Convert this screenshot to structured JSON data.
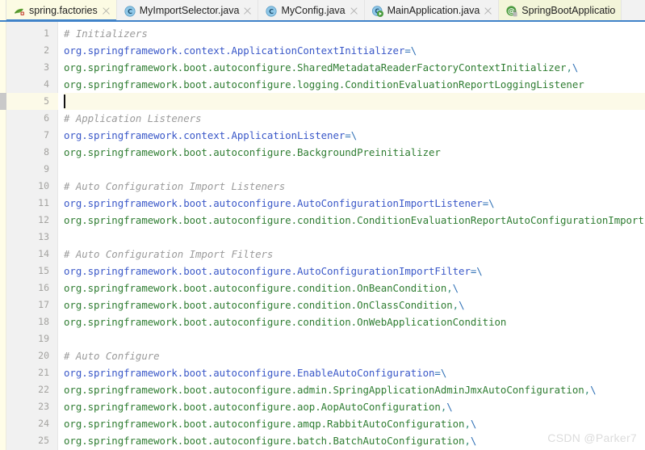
{
  "window": {
    "title": "spring.factories"
  },
  "tabbar": {
    "tabs": [
      {
        "label": "spring.factories",
        "icon": "spring-leaf-icon",
        "active": true,
        "modified": false,
        "closable": true
      },
      {
        "label": "MyImportSelector.java",
        "icon": "java-class-icon",
        "active": false,
        "modified": false,
        "closable": true
      },
      {
        "label": "MyConfig.java",
        "icon": "java-class-icon",
        "active": false,
        "modified": false,
        "closable": true
      },
      {
        "label": "MainApplication.java",
        "icon": "java-runnable-icon",
        "active": false,
        "modified": false,
        "closable": true
      },
      {
        "label": "SpringBootApplicatio",
        "icon": "java-annotation-icon",
        "active": false,
        "modified": true,
        "closable": false
      }
    ]
  },
  "editor": {
    "current_line": 5,
    "lines": [
      {
        "num": 1,
        "tokens": [
          {
            "t": "comment",
            "s": "# Initializers"
          }
        ]
      },
      {
        "num": 2,
        "tokens": [
          {
            "t": "key",
            "s": "org.springframework.context.ApplicationContextInitializer"
          },
          {
            "t": "op",
            "s": "="
          },
          {
            "t": "cont",
            "s": "\\"
          }
        ]
      },
      {
        "num": 3,
        "tokens": [
          {
            "t": "val",
            "s": "org.springframework.boot.autoconfigure.SharedMetadataReaderFactoryContextInitializer"
          },
          {
            "t": "sep",
            "s": ","
          },
          {
            "t": "cont",
            "s": "\\"
          }
        ]
      },
      {
        "num": 4,
        "tokens": [
          {
            "t": "val",
            "s": "org.springframework.boot.autoconfigure.logging.ConditionEvaluationReportLoggingListener"
          }
        ]
      },
      {
        "num": 5,
        "tokens": []
      },
      {
        "num": 6,
        "tokens": [
          {
            "t": "comment",
            "s": "# Application Listeners"
          }
        ]
      },
      {
        "num": 7,
        "tokens": [
          {
            "t": "key",
            "s": "org.springframework.context.ApplicationListener"
          },
          {
            "t": "op",
            "s": "="
          },
          {
            "t": "cont",
            "s": "\\"
          }
        ]
      },
      {
        "num": 8,
        "tokens": [
          {
            "t": "val",
            "s": "org.springframework.boot.autoconfigure.BackgroundPreinitializer"
          }
        ]
      },
      {
        "num": 9,
        "tokens": []
      },
      {
        "num": 10,
        "tokens": [
          {
            "t": "comment",
            "s": "# Auto Configuration Import Listeners"
          }
        ]
      },
      {
        "num": 11,
        "tokens": [
          {
            "t": "key",
            "s": "org.springframework.boot.autoconfigure.AutoConfigurationImportListener"
          },
          {
            "t": "op",
            "s": "="
          },
          {
            "t": "cont",
            "s": "\\"
          }
        ]
      },
      {
        "num": 12,
        "tokens": [
          {
            "t": "val",
            "s": "org.springframework.boot.autoconfigure.condition.ConditionEvaluationReportAutoConfigurationImportListener"
          }
        ]
      },
      {
        "num": 13,
        "tokens": []
      },
      {
        "num": 14,
        "tokens": [
          {
            "t": "comment",
            "s": "# Auto Configuration Import Filters"
          }
        ]
      },
      {
        "num": 15,
        "tokens": [
          {
            "t": "key",
            "s": "org.springframework.boot.autoconfigure.AutoConfigurationImportFilter"
          },
          {
            "t": "op",
            "s": "="
          },
          {
            "t": "cont",
            "s": "\\"
          }
        ]
      },
      {
        "num": 16,
        "tokens": [
          {
            "t": "val",
            "s": "org.springframework.boot.autoconfigure.condition.OnBeanCondition"
          },
          {
            "t": "sep",
            "s": ","
          },
          {
            "t": "cont",
            "s": "\\"
          }
        ]
      },
      {
        "num": 17,
        "tokens": [
          {
            "t": "val",
            "s": "org.springframework.boot.autoconfigure.condition.OnClassCondition"
          },
          {
            "t": "sep",
            "s": ","
          },
          {
            "t": "cont",
            "s": "\\"
          }
        ]
      },
      {
        "num": 18,
        "tokens": [
          {
            "t": "val",
            "s": "org.springframework.boot.autoconfigure.condition.OnWebApplicationCondition"
          }
        ]
      },
      {
        "num": 19,
        "tokens": []
      },
      {
        "num": 20,
        "tokens": [
          {
            "t": "comment",
            "s": "# Auto Configure"
          }
        ]
      },
      {
        "num": 21,
        "tokens": [
          {
            "t": "key",
            "s": "org.springframework.boot.autoconfigure.EnableAutoConfiguration"
          },
          {
            "t": "op",
            "s": "="
          },
          {
            "t": "cont",
            "s": "\\"
          }
        ]
      },
      {
        "num": 22,
        "tokens": [
          {
            "t": "val",
            "s": "org.springframework.boot.autoconfigure.admin.SpringApplicationAdminJmxAutoConfiguration"
          },
          {
            "t": "sep",
            "s": ","
          },
          {
            "t": "cont",
            "s": "\\"
          }
        ]
      },
      {
        "num": 23,
        "tokens": [
          {
            "t": "val",
            "s": "org.springframework.boot.autoconfigure.aop.AopAutoConfiguration"
          },
          {
            "t": "sep",
            "s": ","
          },
          {
            "t": "cont",
            "s": "\\"
          }
        ]
      },
      {
        "num": 24,
        "tokens": [
          {
            "t": "val",
            "s": "org.springframework.boot.autoconfigure.amqp.RabbitAutoConfiguration"
          },
          {
            "t": "sep",
            "s": ","
          },
          {
            "t": "cont",
            "s": "\\"
          }
        ]
      },
      {
        "num": 25,
        "tokens": [
          {
            "t": "val",
            "s": "org.springframework.boot.autoconfigure.batch.BatchAutoConfiguration"
          },
          {
            "t": "sep",
            "s": ","
          },
          {
            "t": "cont",
            "s": "\\"
          }
        ]
      }
    ]
  },
  "watermark": {
    "text": "CSDN @Parker7"
  },
  "colors": {
    "accent_tab_underline": "#4083c9",
    "active_tab_bg": "#fcfbe3",
    "modified_tab_bg": "#f3f5d9",
    "comment": "#9b9b9b",
    "property_key": "#3a58c8",
    "property_value": "#2f7d32",
    "operator": "#2d6fb5",
    "gutter_bg": "#f1f1f1",
    "line_number": "#a4a3a0",
    "current_line_bg": "#fcfae8",
    "watermark": "#dcdcdc"
  }
}
